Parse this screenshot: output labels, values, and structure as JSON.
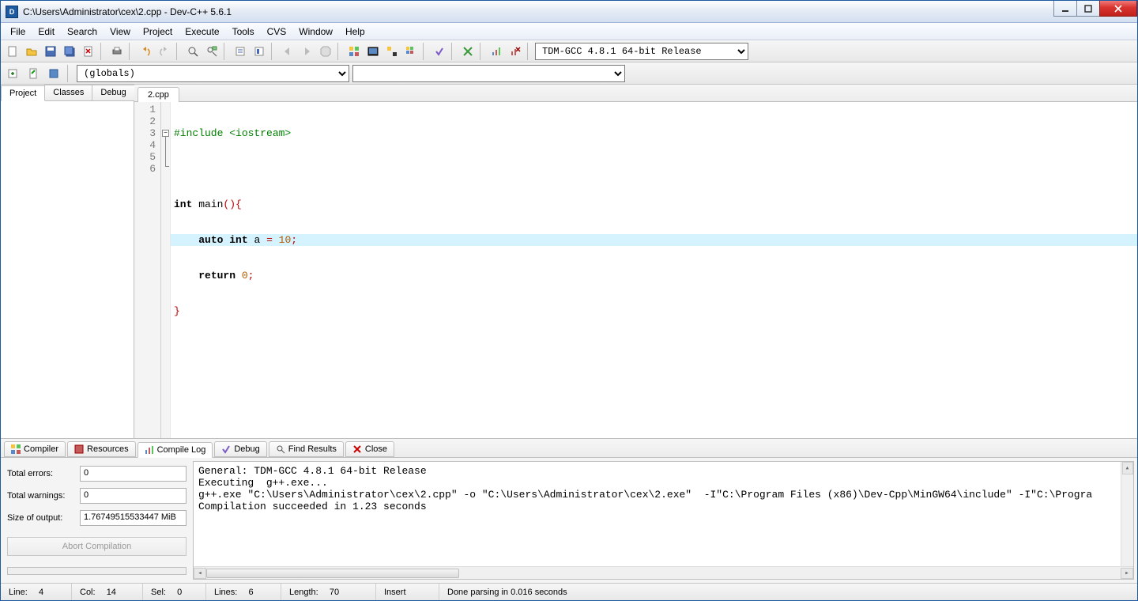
{
  "window": {
    "title": "C:\\Users\\Administrator\\cex\\2.cpp - Dev-C++ 5.6.1"
  },
  "menu": [
    "File",
    "Edit",
    "Search",
    "View",
    "Project",
    "Execute",
    "Tools",
    "CVS",
    "Window",
    "Help"
  ],
  "compiler_select": "TDM-GCC 4.8.1 64-bit Release",
  "globals_combo": "(globals)",
  "left_tabs": [
    "Project",
    "Classes",
    "Debug"
  ],
  "file_tab": "2.cpp",
  "code": {
    "lines": [
      "1",
      "2",
      "3",
      "4",
      "5",
      "6"
    ],
    "l1_include": "#include <iostream>",
    "l3_kw1": "int",
    "l3_name": " main",
    "l3_paren": "()",
    "l3_brace": "{",
    "l4_kw1": "auto",
    "l4_kw2": "int",
    "l4_var": " a ",
    "l4_eq": "=",
    "l4_num": " 10",
    "l4_semi": ";",
    "l5_kw": "return",
    "l5_num": " 0",
    "l5_semi": ";",
    "l6_brace": "}"
  },
  "bottom_tabs": [
    "Compiler",
    "Resources",
    "Compile Log",
    "Debug",
    "Find Results",
    "Close"
  ],
  "compile_info": {
    "errors_label": "Total errors:",
    "errors": "0",
    "warnings_label": "Total warnings:",
    "warnings": "0",
    "size_label": "Size of output:",
    "size": "1.76749515533447 MiB",
    "abort": "Abort Compilation"
  },
  "log": "General: TDM-GCC 4.8.1 64-bit Release\nExecuting  g++.exe...\ng++.exe \"C:\\Users\\Administrator\\cex\\2.cpp\" -o \"C:\\Users\\Administrator\\cex\\2.exe\"  -I\"C:\\Program Files (x86)\\Dev-Cpp\\MinGW64\\include\" -I\"C:\\Progra\nCompilation succeeded in 1.23 seconds",
  "status": {
    "line_lbl": "Line:",
    "line": "4",
    "col_lbl": "Col:",
    "col": "14",
    "sel_lbl": "Sel:",
    "sel": "0",
    "lines_lbl": "Lines:",
    "lines": "6",
    "len_lbl": "Length:",
    "len": "70",
    "mode": "Insert",
    "parse": "Done parsing in 0.016 seconds"
  }
}
